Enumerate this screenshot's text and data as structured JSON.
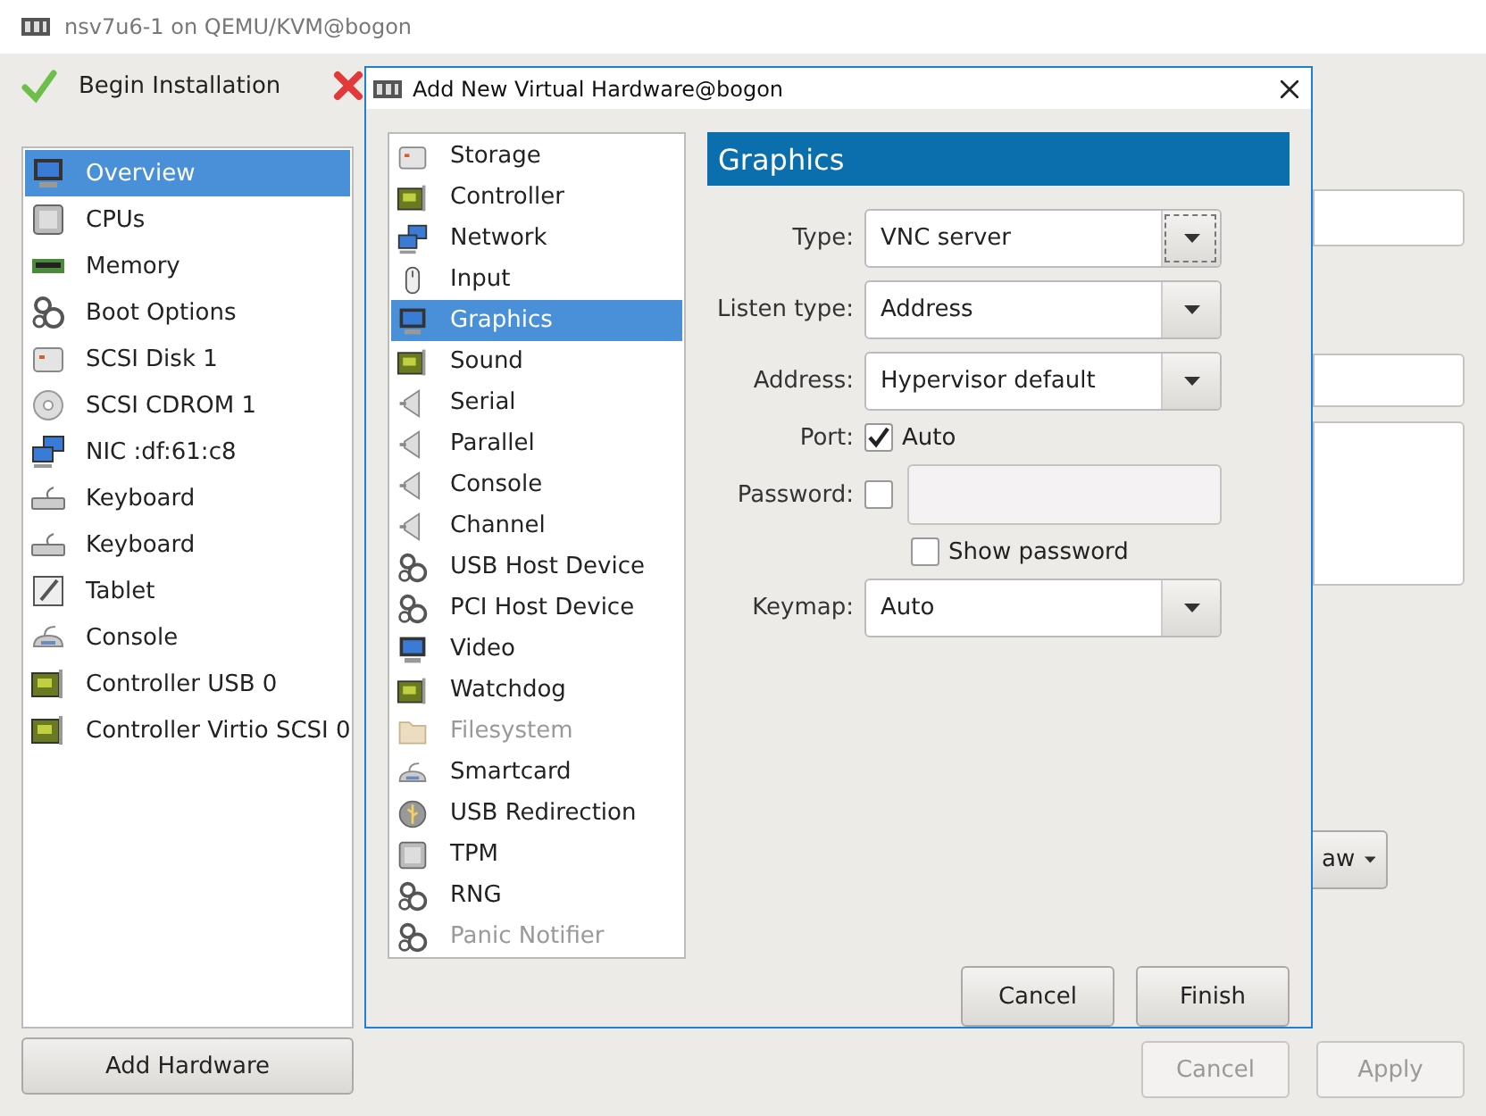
{
  "window": {
    "title": "nsv7u6-1 on QEMU/KVM@bogon"
  },
  "toolbar": [
    {
      "kind": "check",
      "label": "Begin Installation"
    },
    {
      "kind": "cross"
    }
  ],
  "sidebar": {
    "items": [
      {
        "label": "Overview",
        "kind": "monitor",
        "selected": true
      },
      {
        "label": "CPUs",
        "kind": "chip",
        "selected": false
      },
      {
        "label": "Memory",
        "kind": "memory",
        "selected": false
      },
      {
        "label": "Boot Options",
        "kind": "gears",
        "selected": false
      },
      {
        "label": "SCSI Disk 1",
        "kind": "disk",
        "selected": false
      },
      {
        "label": "SCSI CDROM 1",
        "kind": "cdrom",
        "selected": false
      },
      {
        "label": "NIC :df:61:c8",
        "kind": "network",
        "selected": false
      },
      {
        "label": "Keyboard",
        "kind": "keyboard",
        "selected": false
      },
      {
        "label": "Keyboard",
        "kind": "keyboard",
        "selected": false
      },
      {
        "label": "Tablet",
        "kind": "tablet",
        "selected": false
      },
      {
        "label": "Console",
        "kind": "console",
        "selected": false
      },
      {
        "label": "Controller USB 0",
        "kind": "card",
        "selected": false
      },
      {
        "label": "Controller Virtio SCSI 0",
        "kind": "card",
        "selected": false
      }
    ],
    "add_button": "Add Hardware"
  },
  "background_panel": {
    "menu_button": "aw",
    "buttons": [
      {
        "label": "Cancel",
        "disabled": true
      },
      {
        "label": "Apply",
        "disabled": true
      }
    ]
  },
  "dialog": {
    "title": "Add New Virtual Hardware@bogon",
    "items": [
      {
        "label": "Storage",
        "kind": "disk",
        "selected": false,
        "disabled": false
      },
      {
        "label": "Controller",
        "kind": "card",
        "selected": false,
        "disabled": false
      },
      {
        "label": "Network",
        "kind": "network",
        "selected": false,
        "disabled": false
      },
      {
        "label": "Input",
        "kind": "mouse",
        "selected": false,
        "disabled": false
      },
      {
        "label": "Graphics",
        "kind": "monitor",
        "selected": true,
        "disabled": false
      },
      {
        "label": "Sound",
        "kind": "card",
        "selected": false,
        "disabled": false
      },
      {
        "label": "Serial",
        "kind": "port",
        "selected": false,
        "disabled": false
      },
      {
        "label": "Parallel",
        "kind": "port",
        "selected": false,
        "disabled": false
      },
      {
        "label": "Console",
        "kind": "port",
        "selected": false,
        "disabled": false
      },
      {
        "label": "Channel",
        "kind": "port",
        "selected": false,
        "disabled": false
      },
      {
        "label": "USB Host Device",
        "kind": "gears",
        "selected": false,
        "disabled": false
      },
      {
        "label": "PCI Host Device",
        "kind": "gears",
        "selected": false,
        "disabled": false
      },
      {
        "label": "Video",
        "kind": "monitor",
        "selected": false,
        "disabled": false
      },
      {
        "label": "Watchdog",
        "kind": "card",
        "selected": false,
        "disabled": false
      },
      {
        "label": "Filesystem",
        "kind": "folder",
        "selected": false,
        "disabled": true
      },
      {
        "label": "Smartcard",
        "kind": "console",
        "selected": false,
        "disabled": false
      },
      {
        "label": "USB Redirection",
        "kind": "usb",
        "selected": false,
        "disabled": false
      },
      {
        "label": "TPM",
        "kind": "chip",
        "selected": false,
        "disabled": false
      },
      {
        "label": "RNG",
        "kind": "gears",
        "selected": false,
        "disabled": false
      },
      {
        "label": "Panic Notifier",
        "kind": "gears",
        "selected": false,
        "disabled": true
      }
    ],
    "header": "Graphics",
    "fields": [
      {
        "kind": "combo",
        "label": "Type:",
        "value": "VNC server",
        "focused": true
      },
      {
        "kind": "combo",
        "label": "Listen type:",
        "value": "Address",
        "focused": false
      },
      {
        "kind": "combo",
        "label": "Address:",
        "value": "Hypervisor default",
        "focused": false
      },
      {
        "kind": "check",
        "label": "Port:",
        "text": "Auto",
        "checked": true
      },
      {
        "kind": "password",
        "label": "Password:",
        "checked": false,
        "disabled": true
      },
      {
        "kind": "check",
        "text": "Show password",
        "checked": false
      },
      {
        "kind": "combo",
        "label": "Keymap:",
        "value": "Auto",
        "focused": false
      }
    ],
    "buttons": [
      "Cancel",
      "Finish"
    ]
  }
}
